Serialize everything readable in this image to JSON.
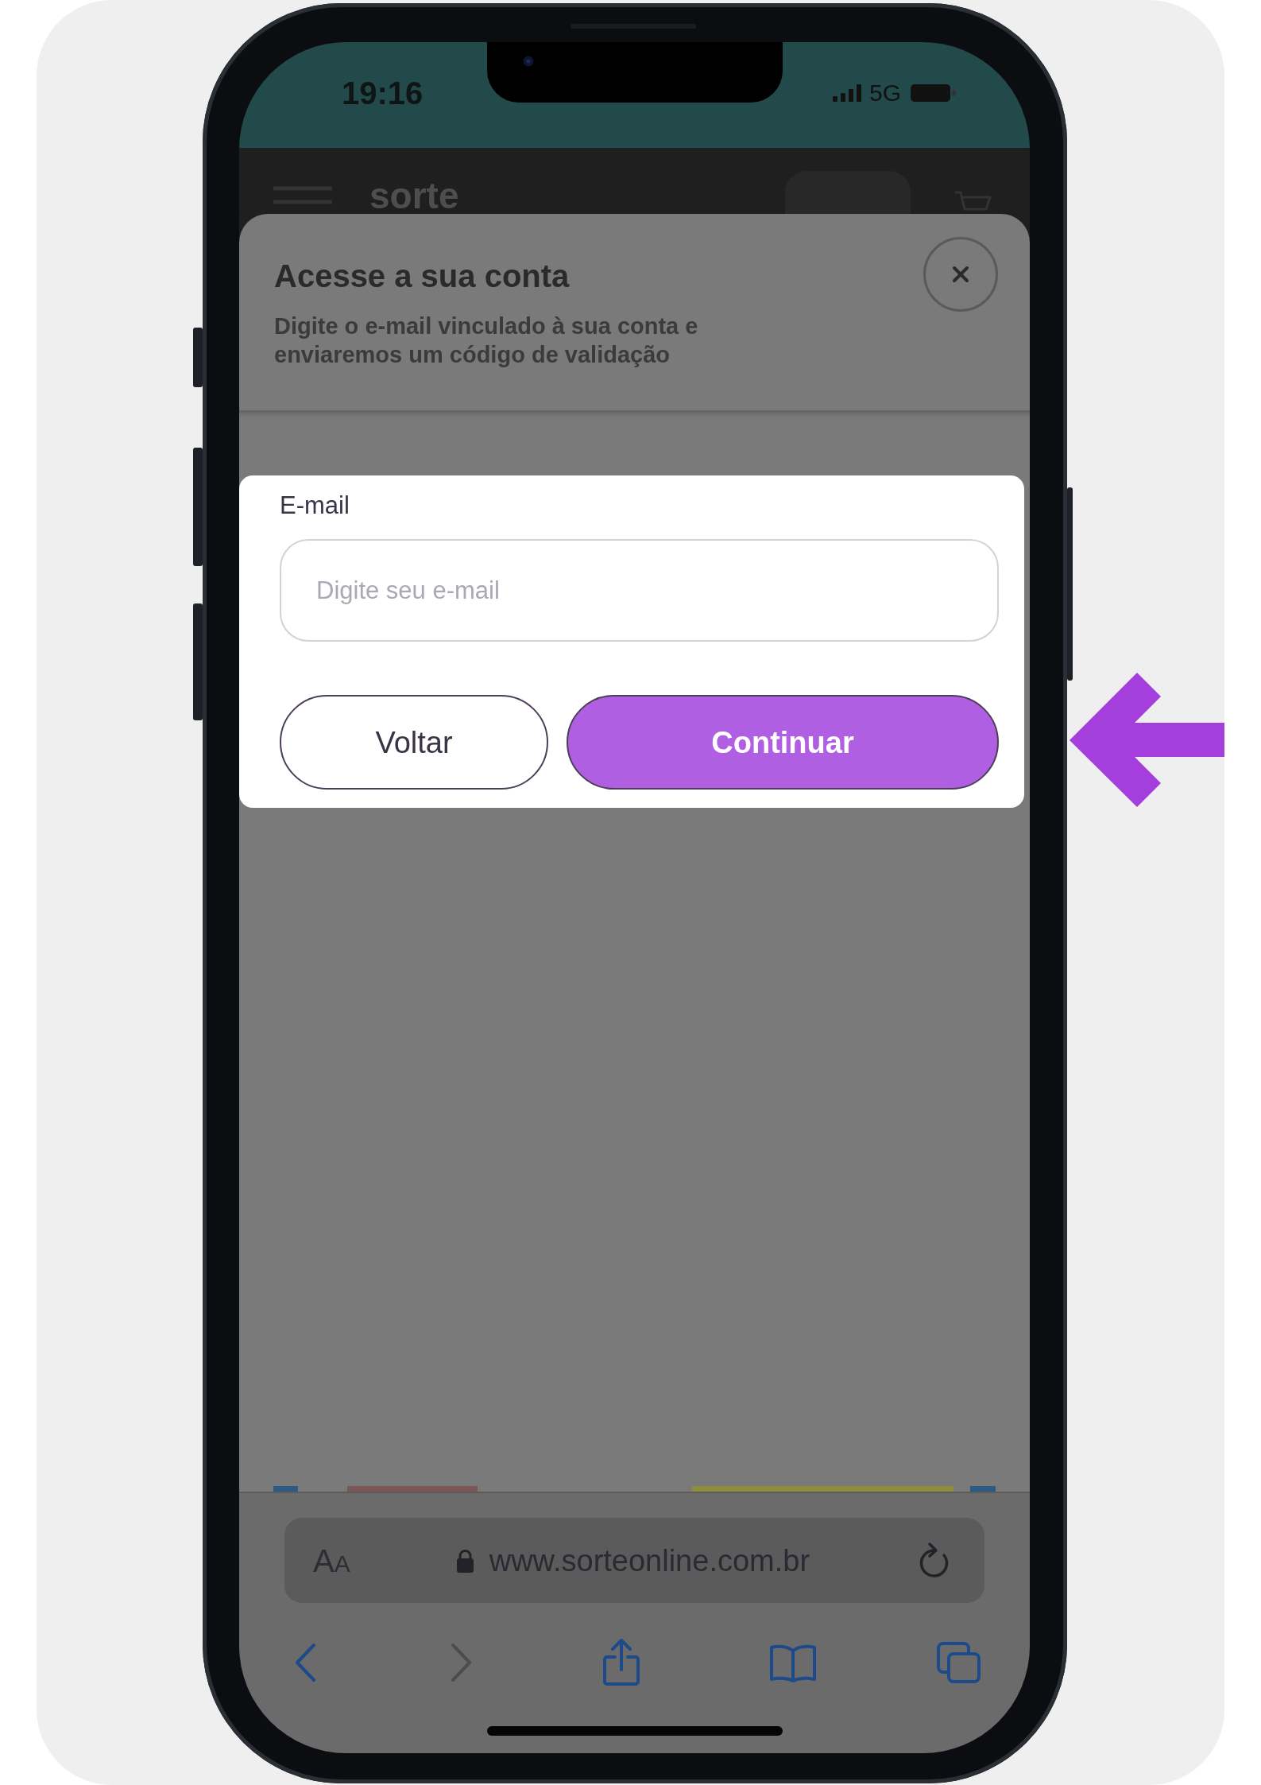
{
  "status_bar": {
    "time": "19:16",
    "network": "5G"
  },
  "site_header": {
    "logo": "sorte"
  },
  "sheet": {
    "title": "Acesse a sua conta",
    "subtitle": "Digite o e-mail vinculado à sua conta e enviaremos um código de validação"
  },
  "form": {
    "label": "E-mail",
    "email": {
      "placeholder": "Digite seu e-mail"
    },
    "buttons": [
      {
        "label": "Voltar",
        "kind": "secondary"
      },
      {
        "label": "Continuar",
        "kind": "primary"
      }
    ]
  },
  "browser": {
    "text_size": "AA",
    "url": "www.sorteonline.com.br",
    "toolbar": [
      {
        "kind": "back",
        "disabled": false
      },
      {
        "kind": "forward",
        "disabled": true
      },
      {
        "kind": "share",
        "disabled": false
      },
      {
        "kind": "bookmarks",
        "disabled": false
      },
      {
        "kind": "tabs",
        "disabled": false
      }
    ]
  }
}
